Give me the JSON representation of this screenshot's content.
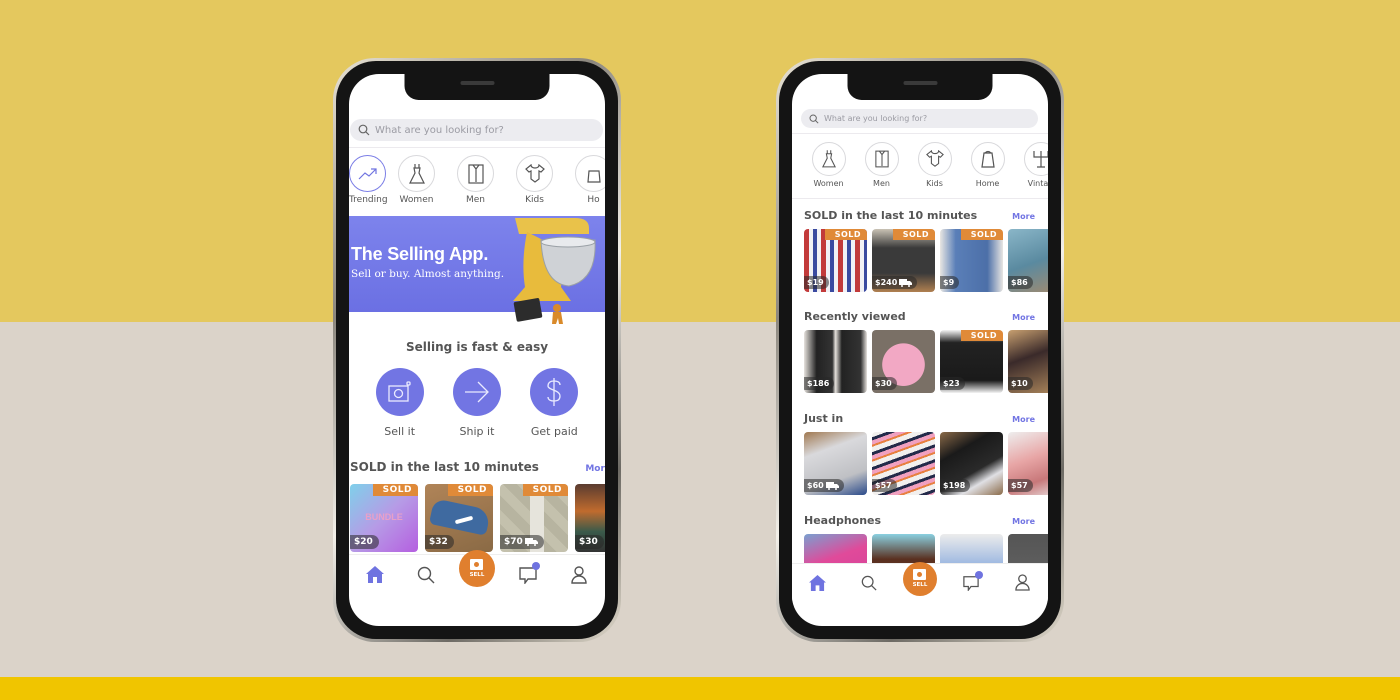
{
  "colors": {
    "accent": "#7275e3",
    "sell_orange": "#e07f2e",
    "sold_badge": "#e08a38",
    "bg_yellow": "#e4c85e",
    "bg_beige": "#dbd3c9",
    "bg_band": "#f0c500"
  },
  "phone1": {
    "search": {
      "placeholder": "What are you looking for?",
      "icon": "search-icon"
    },
    "categories": [
      {
        "label": "Trending",
        "icon": "trending-icon",
        "active": true
      },
      {
        "label": "Women",
        "icon": "dress-icon"
      },
      {
        "label": "Men",
        "icon": "shirt-icon"
      },
      {
        "label": "Kids",
        "icon": "onesie-icon"
      },
      {
        "label": "Ho",
        "icon": "home-icon"
      }
    ],
    "banner": {
      "title": "The Selling App.",
      "subtitle": "Sell or buy. Almost anything."
    },
    "steps": {
      "title": "Selling is fast & easy",
      "items": [
        {
          "label": "Sell it",
          "icon": "camera-icon"
        },
        {
          "label": "Ship it",
          "icon": "arrow-right-icon"
        },
        {
          "label": "Get paid",
          "icon": "dollar-icon"
        }
      ]
    },
    "sold_section": {
      "title": "SOLD in the last 10 minutes",
      "more": "More",
      "items": [
        {
          "price": "$20",
          "sold": "SOLD",
          "image": "bundle",
          "overlay": "BUNDLE"
        },
        {
          "price": "$32",
          "sold": "SOLD",
          "image": "sneakers"
        },
        {
          "price": "$70",
          "sold": "SOLD",
          "image": "wallpaper",
          "shipping": true
        },
        {
          "price": "$30",
          "image": "toys"
        }
      ]
    },
    "tabbar": {
      "sell_label": "SELL"
    }
  },
  "phone2": {
    "search": {
      "placeholder": "What are you looking for?",
      "icon": "search-icon"
    },
    "categories": [
      {
        "label": "Women",
        "icon": "dress-icon"
      },
      {
        "label": "Men",
        "icon": "shirt-icon"
      },
      {
        "label": "Kids",
        "icon": "onesie-icon"
      },
      {
        "label": "Home",
        "icon": "kettle-icon"
      },
      {
        "label": "Vintag",
        "icon": "candelabra-icon"
      }
    ],
    "sections": [
      {
        "title": "SOLD in the last 10 minutes",
        "more": "More",
        "items": [
          {
            "price": "$19",
            "sold": "SOLD",
            "image": "plaid-shirt"
          },
          {
            "price": "$240",
            "sold": "SOLD",
            "image": "switch",
            "shipping": true
          },
          {
            "price": "$9",
            "sold": "SOLD",
            "image": "jeans"
          },
          {
            "price": "$86",
            "image": "sunglasses"
          }
        ]
      },
      {
        "title": "Recently viewed",
        "more": "More",
        "items": [
          {
            "price": "$186",
            "image": "hightops"
          },
          {
            "price": "$30",
            "image": "instax"
          },
          {
            "price": "$23",
            "sold": "SOLD",
            "image": "coffee-maker"
          },
          {
            "price": "$10",
            "image": "bag"
          }
        ]
      },
      {
        "title": "Just in",
        "more": "More",
        "items": [
          {
            "price": "$60",
            "image": "silver-sneakers",
            "shipping": true
          },
          {
            "price": "$57",
            "image": "bedding"
          },
          {
            "price": "$198",
            "image": "iphone"
          },
          {
            "price": "$57",
            "image": "pink-sneakers"
          }
        ]
      },
      {
        "title": "Headphones",
        "more": "More",
        "items": [
          {
            "image": "pink-headphones"
          },
          {
            "image": "blue-headphones"
          },
          {
            "image": "light-blue-headphones"
          },
          {
            "image": "earbuds"
          }
        ]
      }
    ],
    "tabbar": {
      "sell_label": "SELL"
    }
  }
}
